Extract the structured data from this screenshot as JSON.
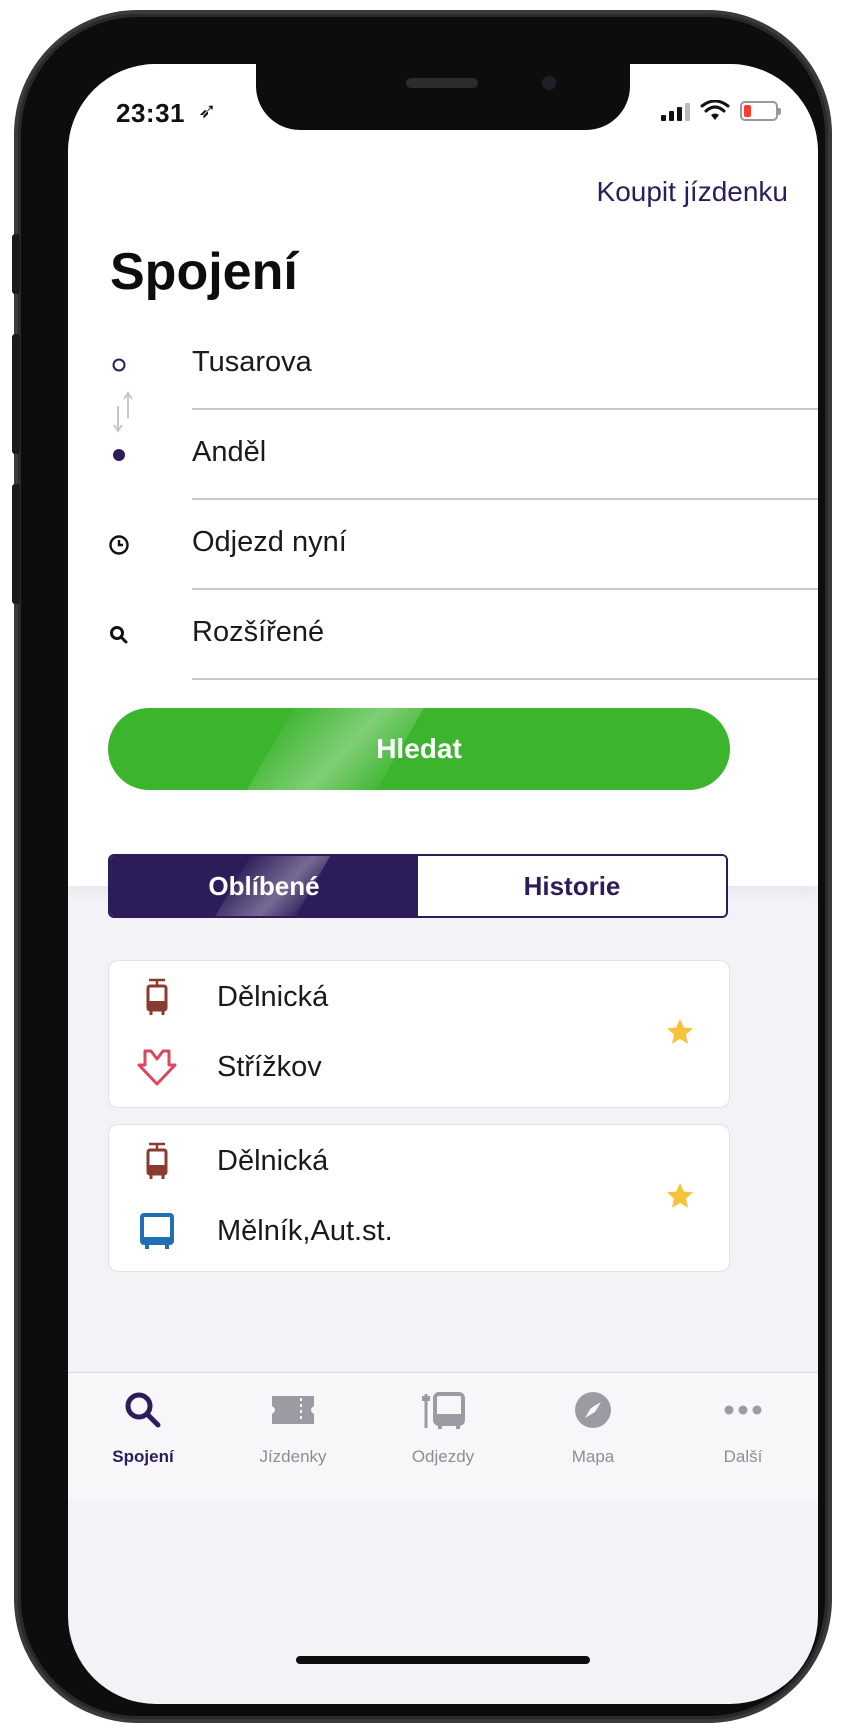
{
  "status_bar": {
    "time": "23:31",
    "location_glyph": "➶",
    "battery_color": "#ff3b30"
  },
  "header": {
    "buy_ticket_label": "Koupit jízdenku",
    "title": "Spojení"
  },
  "form": {
    "from": "Tusarova",
    "to": "Anděl",
    "time": "Odjezd nyní",
    "advanced": "Rozšířené",
    "search_label": "Hledat"
  },
  "segments": {
    "favorites": "Oblíbené",
    "history": "Historie"
  },
  "favorites": [
    {
      "from": {
        "name": "Dělnická",
        "mode": "tram-icon"
      },
      "to": {
        "name": "Střížkov",
        "mode": "metro-icon"
      },
      "starred": true
    },
    {
      "from": {
        "name": "Dělnická",
        "mode": "tram-icon"
      },
      "to": {
        "name": "Mělník,Aut.st.",
        "mode": "bus-icon"
      },
      "starred": true
    }
  ],
  "tabbar": {
    "connections": "Spojení",
    "tickets": "Jízdenky",
    "departures": "Odjezdy",
    "map": "Mapa",
    "more": "Další"
  },
  "colors": {
    "brand": "#2d1c5a",
    "search_green": "#3cb42e",
    "tram": "#8b3a2f",
    "metro": "#d9485e",
    "bus": "#1f6fb2",
    "star": "#f5c43a"
  }
}
